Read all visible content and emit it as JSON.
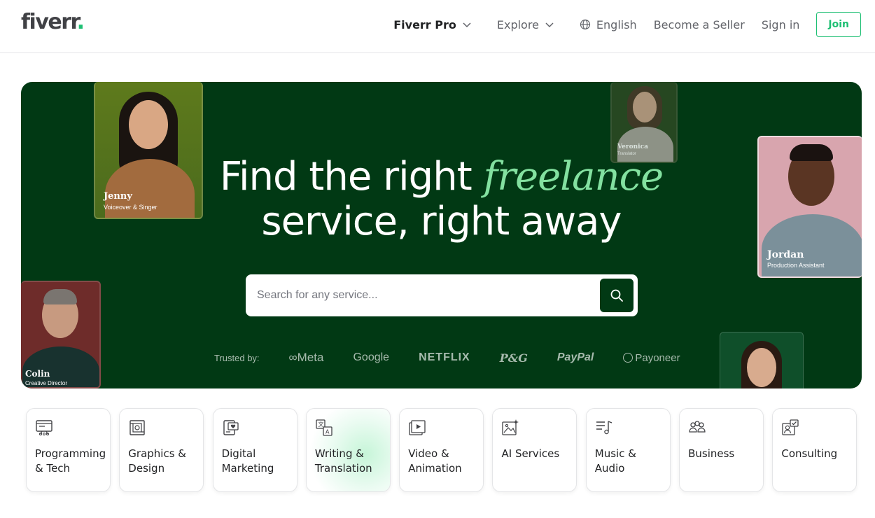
{
  "header": {
    "logo_text": "fiverr",
    "logo_dot": ".",
    "nav": {
      "pro": "Fiverr Pro",
      "explore": "Explore",
      "language": "English",
      "become_seller": "Become a Seller",
      "sign_in": "Sign in",
      "join": "Join"
    }
  },
  "hero": {
    "title_part1": "Find the right ",
    "title_accent": "freelance",
    "title_line2": "service, right away",
    "search_placeholder": "Search for any service...",
    "trusted_label": "Trusted by:",
    "brands": [
      "Meta",
      "Google",
      "NETFLIX",
      "P&G",
      "PayPal",
      "Payoneer"
    ],
    "people": [
      {
        "name": "Jenny",
        "role": "Voiceover & Singer"
      },
      {
        "name": "Veronica",
        "role": "Translator"
      },
      {
        "name": "Jordan",
        "role": "Production Assistant"
      },
      {
        "name": "Colin",
        "role": "Creative Director"
      }
    ]
  },
  "categories": [
    {
      "label": "Programming & Tech",
      "icon": "monitor-icon"
    },
    {
      "label": "Graphics & Design",
      "icon": "design-frame-icon"
    },
    {
      "label": "Digital Marketing",
      "icon": "marketing-icon"
    },
    {
      "label": "Writing & Translation",
      "icon": "translate-icon"
    },
    {
      "label": "Video & Animation",
      "icon": "video-icon"
    },
    {
      "label": "AI Services",
      "icon": "ai-image-icon"
    },
    {
      "label": "Music & Audio",
      "icon": "music-icon"
    },
    {
      "label": "Business",
      "icon": "people-icon"
    },
    {
      "label": "Consulting",
      "icon": "consulting-icon"
    }
  ],
  "colors": {
    "brand_green": "#1dbf73",
    "hero_bg": "#013914",
    "accent_text": "#83e1a0"
  }
}
